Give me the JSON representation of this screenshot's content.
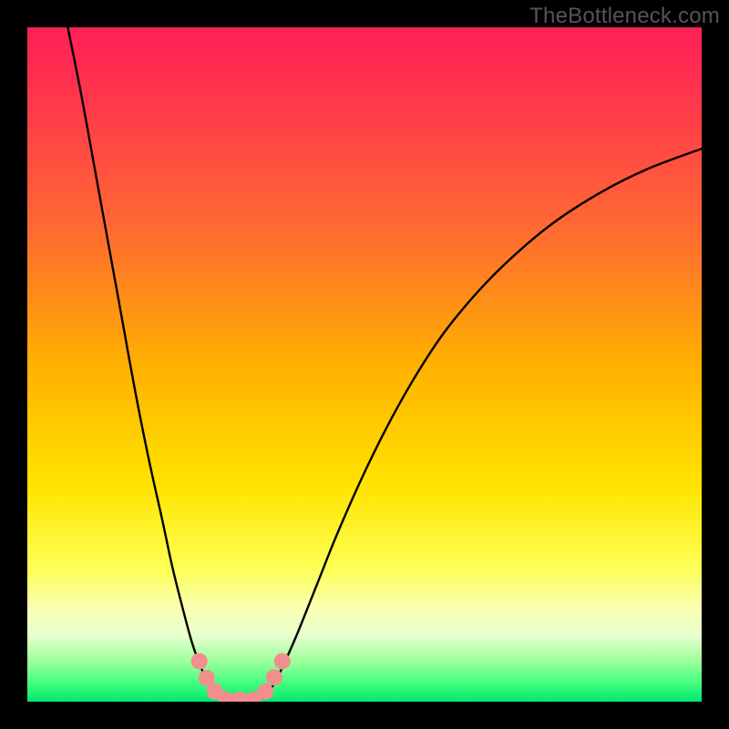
{
  "watermark": "TheBottleneck.com",
  "chart_data": {
    "type": "line",
    "title": "",
    "xlabel": "",
    "ylabel": "",
    "xlim": [
      0,
      100
    ],
    "ylim": [
      0,
      100
    ],
    "background_gradient": {
      "stops": [
        {
          "offset": 0.0,
          "color": "#ff1f55"
        },
        {
          "offset": 0.12,
          "color": "#ff3a4a"
        },
        {
          "offset": 0.3,
          "color": "#ff6a32"
        },
        {
          "offset": 0.5,
          "color": "#ffb000"
        },
        {
          "offset": 0.68,
          "color": "#ffe400"
        },
        {
          "offset": 0.8,
          "color": "#fdff53"
        },
        {
          "offset": 0.86,
          "color": "#fbffb0"
        },
        {
          "offset": 0.9,
          "color": "#e9ffd0"
        },
        {
          "offset": 0.94,
          "color": "#9cff9c"
        },
        {
          "offset": 0.97,
          "color": "#4bff82"
        },
        {
          "offset": 1.0,
          "color": "#00e86e"
        }
      ]
    },
    "series": [
      {
        "name": "left-branch",
        "type": "line",
        "points": [
          {
            "x": 6.0,
            "y": 100.0
          },
          {
            "x": 8.0,
            "y": 90.0
          },
          {
            "x": 10.0,
            "y": 79.0
          },
          {
            "x": 12.0,
            "y": 68.0
          },
          {
            "x": 14.0,
            "y": 57.0
          },
          {
            "x": 16.0,
            "y": 46.0
          },
          {
            "x": 18.0,
            "y": 36.0
          },
          {
            "x": 20.0,
            "y": 27.0
          },
          {
            "x": 21.5,
            "y": 20.0
          },
          {
            "x": 23.0,
            "y": 14.0
          },
          {
            "x": 24.5,
            "y": 8.5
          },
          {
            "x": 26.0,
            "y": 4.5
          },
          {
            "x": 27.0,
            "y": 2.5
          },
          {
            "x": 28.0,
            "y": 1.0
          },
          {
            "x": 29.0,
            "y": 0.3
          },
          {
            "x": 30.5,
            "y": 0.0
          }
        ]
      },
      {
        "name": "right-branch",
        "type": "line",
        "points": [
          {
            "x": 33.5,
            "y": 0.0
          },
          {
            "x": 35.0,
            "y": 0.8
          },
          {
            "x": 36.5,
            "y": 2.5
          },
          {
            "x": 38.0,
            "y": 5.5
          },
          {
            "x": 40.0,
            "y": 10.0
          },
          {
            "x": 43.0,
            "y": 17.5
          },
          {
            "x": 46.0,
            "y": 25.0
          },
          {
            "x": 50.0,
            "y": 34.0
          },
          {
            "x": 54.0,
            "y": 42.0
          },
          {
            "x": 58.0,
            "y": 49.0
          },
          {
            "x": 62.0,
            "y": 55.0
          },
          {
            "x": 67.0,
            "y": 61.0
          },
          {
            "x": 72.0,
            "y": 66.0
          },
          {
            "x": 78.0,
            "y": 71.0
          },
          {
            "x": 85.0,
            "y": 75.5
          },
          {
            "x": 92.0,
            "y": 79.0
          },
          {
            "x": 100.0,
            "y": 82.0
          }
        ]
      },
      {
        "name": "markers",
        "type": "scatter",
        "color": "#f28e8e",
        "points": [
          {
            "x": 25.5,
            "y": 6.0
          },
          {
            "x": 26.6,
            "y": 3.5
          },
          {
            "x": 27.8,
            "y": 1.5
          },
          {
            "x": 29.5,
            "y": 0.3
          },
          {
            "x": 31.5,
            "y": 0.3
          },
          {
            "x": 33.5,
            "y": 0.3
          },
          {
            "x": 35.3,
            "y": 1.5
          },
          {
            "x": 36.6,
            "y": 3.6
          },
          {
            "x": 37.8,
            "y": 6.0
          }
        ]
      }
    ]
  }
}
